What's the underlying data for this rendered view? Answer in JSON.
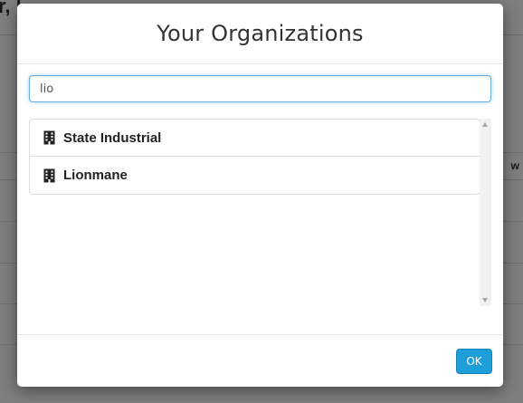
{
  "background": {
    "title_fragment": "r, l",
    "side_fragment": "w"
  },
  "modal": {
    "title": "Your Organizations",
    "search": {
      "value": "lio",
      "placeholder": ""
    },
    "organizations": [
      {
        "label": "State Industrial",
        "icon": "building-icon"
      },
      {
        "label": "Lionmane",
        "icon": "building-icon"
      }
    ],
    "ok_label": "OK"
  },
  "colors": {
    "primary_button": "#1e9ed8",
    "focus_border": "#66afe9"
  }
}
